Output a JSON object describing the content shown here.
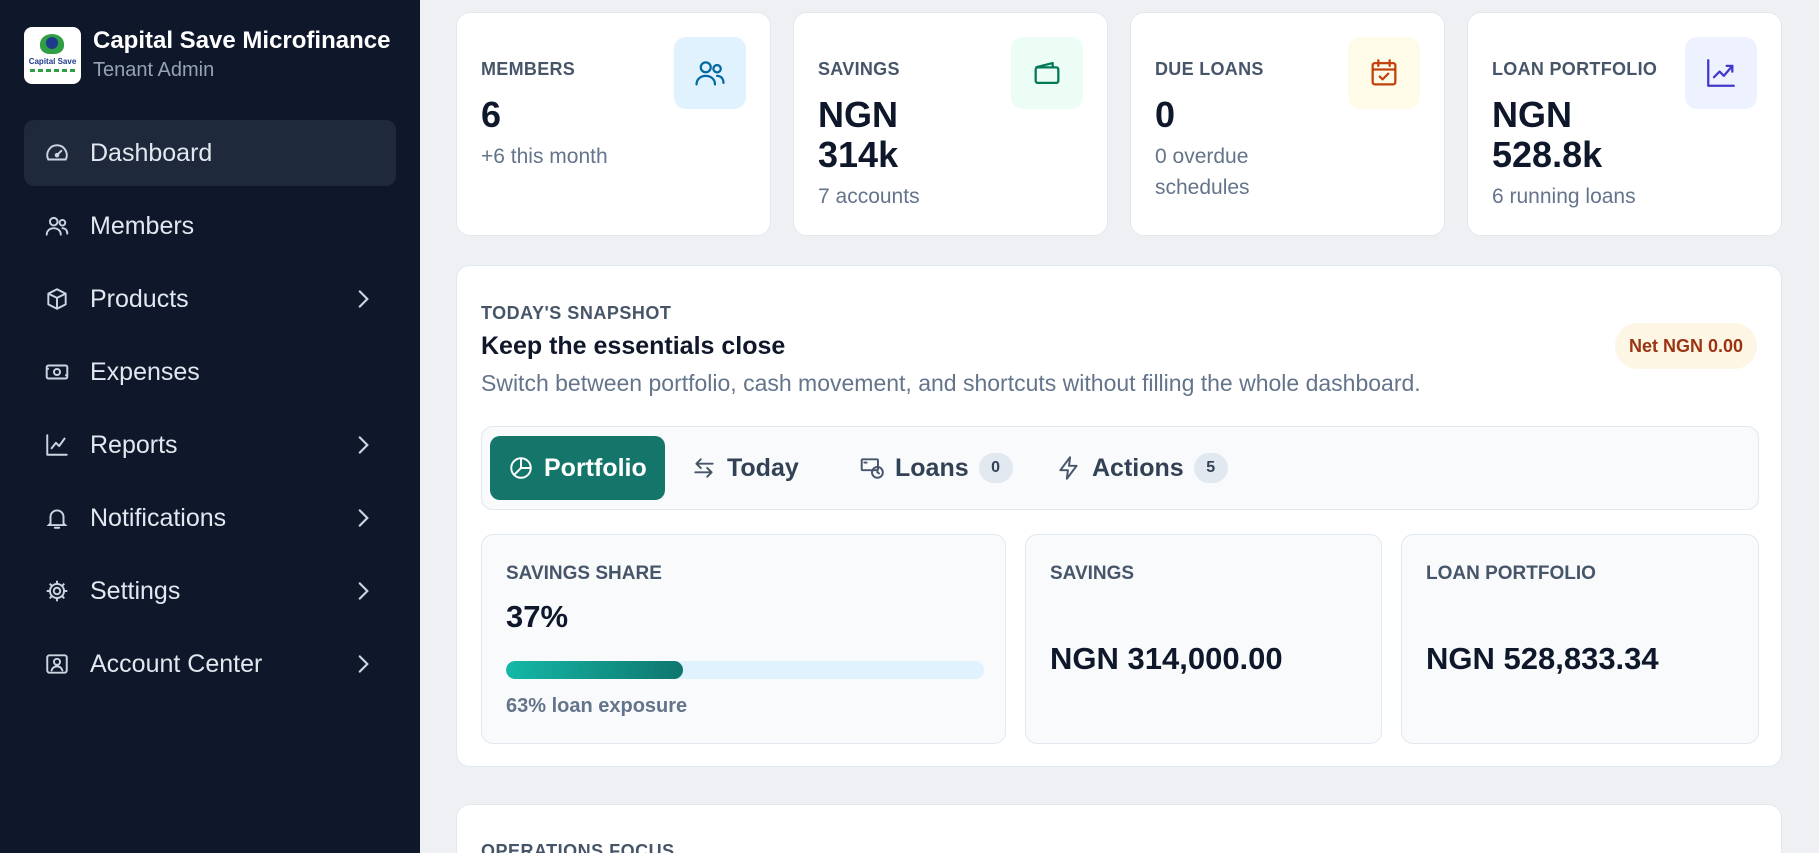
{
  "brand": {
    "name": "Capital Save Microfinance",
    "role": "Tenant Admin",
    "logo_text": "Capital Save"
  },
  "sidebar": {
    "items": [
      {
        "label": "Dashboard",
        "icon": "gauge-icon",
        "active": true,
        "has_submenu": false
      },
      {
        "label": "Members",
        "icon": "users-icon",
        "active": false,
        "has_submenu": false
      },
      {
        "label": "Products",
        "icon": "box-icon",
        "active": false,
        "has_submenu": true
      },
      {
        "label": "Expenses",
        "icon": "cash-icon",
        "active": false,
        "has_submenu": false
      },
      {
        "label": "Reports",
        "icon": "chart-line-icon",
        "active": false,
        "has_submenu": true
      },
      {
        "label": "Notifications",
        "icon": "bell-icon",
        "active": false,
        "has_submenu": true
      },
      {
        "label": "Settings",
        "icon": "gear-icon",
        "active": false,
        "has_submenu": true
      },
      {
        "label": "Account Center",
        "icon": "id-card-icon",
        "active": false,
        "has_submenu": true
      }
    ]
  },
  "stats": [
    {
      "label": "MEMBERS",
      "value": "6",
      "sub": "+6 this month",
      "icon": "users-icon",
      "icon_bg": "#e0f2fe",
      "icon_color": "#0369a1"
    },
    {
      "label": "SAVINGS",
      "value": "NGN 314k",
      "sub": "7 accounts",
      "icon": "wallet-icon",
      "icon_bg": "#ecfdf5",
      "icon_color": "#047857"
    },
    {
      "label": "DUE LOANS",
      "value": "0",
      "sub": "0 overdue schedules",
      "icon": "calendar-check-icon",
      "icon_bg": "#fefce8",
      "icon_color": "#c2410c"
    },
    {
      "label": "LOAN PORTFOLIO",
      "value": "NGN 528.8k",
      "sub": "6 running loans",
      "icon": "trend-up-icon",
      "icon_bg": "#eef2ff",
      "icon_color": "#4338ca"
    }
  ],
  "snapshot": {
    "eyebrow": "TODAY'S SNAPSHOT",
    "title": "Keep the essentials close",
    "description": "Switch between portfolio, cash movement, and shortcuts without filling the whole dashboard.",
    "net_badge": "Net NGN 0.00",
    "tabs": [
      {
        "label": "Portfolio",
        "icon": "pie-chart-icon",
        "active": true
      },
      {
        "label": "Today",
        "icon": "arrows-swap-icon",
        "active": false
      },
      {
        "label": "Loans",
        "icon": "money-clock-icon",
        "active": false,
        "count": "0"
      },
      {
        "label": "Actions",
        "icon": "bolt-icon",
        "active": false,
        "count": "5"
      }
    ],
    "panels": {
      "savings_share": {
        "label": "SAVINGS SHARE",
        "value": "37%",
        "progress": 0.37,
        "note": "63% loan exposure"
      },
      "savings": {
        "label": "SAVINGS",
        "amount": "NGN 314,000.00"
      },
      "loan_portfolio": {
        "label": "LOAN PORTFOLIO",
        "amount": "NGN 528,833.34"
      }
    }
  },
  "operations": {
    "eyebrow": "OPERATIONS FOCUS"
  },
  "colors": {
    "sidebar_bg": "#0f172a",
    "accent": "#14766a",
    "page_bg": "#eef0f4"
  }
}
